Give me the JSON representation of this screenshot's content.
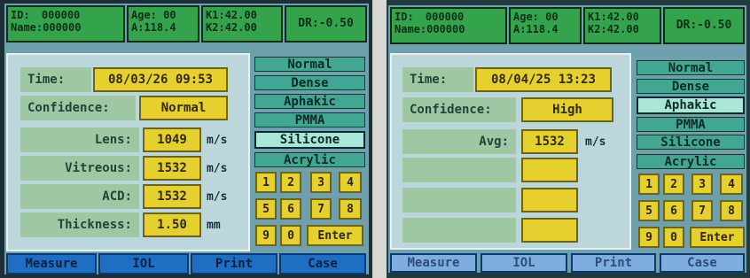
{
  "left": {
    "header": {
      "id_label": "ID:",
      "id_value": "000000",
      "name_label": "Name:",
      "name_value": "000000",
      "age_label": "Age:",
      "age_value": "00",
      "a_label": "A:",
      "a_value": "118.4",
      "k1_label": "K1:",
      "k1_value": "42.00",
      "k2_label": "K2:",
      "k2_value": "42.00",
      "dr_label": "DR:",
      "dr_value": "-0.50"
    },
    "time": {
      "label": "Time:",
      "value": "08/03/26 09:53"
    },
    "confidence": {
      "label": "Confidence:",
      "value": "Normal"
    },
    "rows": [
      {
        "label": "Lens:",
        "value": "1049",
        "unit": "m/s"
      },
      {
        "label": "Vitreous:",
        "value": "1532",
        "unit": "m/s"
      },
      {
        "label": "ACD:",
        "value": "1532",
        "unit": "m/s"
      },
      {
        "label": "Thickness:",
        "value": "1.50",
        "unit": "mm"
      }
    ],
    "modes": [
      "Normal",
      "Dense",
      "Aphakic",
      "PMMA",
      "Silicone",
      "Acrylic"
    ],
    "selected_mode": "Silicone",
    "keys": [
      "1",
      "2",
      "3",
      "4",
      "5",
      "6",
      "7",
      "8",
      "9",
      "0",
      "Enter"
    ],
    "tabs": [
      "Measure",
      "IOL",
      "Print",
      "Case"
    ]
  },
  "right": {
    "header": {
      "id_label": "ID:",
      "id_value": "000000",
      "name_label": "Name:",
      "name_value": "000000",
      "age_label": "Age:",
      "age_value": "00",
      "a_label": "A:",
      "a_value": "118.4",
      "k1_label": "K1:",
      "k1_value": "42.00",
      "k2_label": "K2:",
      "k2_value": "42.00",
      "dr_label": "DR:",
      "dr_value": "-0.50"
    },
    "time": {
      "label": "Time:",
      "value": "08/04/25 13:23"
    },
    "confidence": {
      "label": "Confidence:",
      "value": "High"
    },
    "avg": {
      "label": "Avg:",
      "value": "1532",
      "unit": "m/s"
    },
    "modes": [
      "Normal",
      "Dense",
      "Aphakic",
      "PMMA",
      "Silicone",
      "Acrylic"
    ],
    "selected_mode": "Aphakic",
    "keys": [
      "1",
      "2",
      "3",
      "4",
      "5",
      "6",
      "7",
      "8",
      "9",
      "0",
      "Enter"
    ],
    "tabs": [
      "Measure",
      "IOL",
      "Print",
      "Case"
    ]
  },
  "colors": {
    "header_green": "#34a44c",
    "field_yellow": "#e6d02e",
    "mode_teal": "#41a792",
    "tab_blue": "#1e6fc4",
    "screen_bg": "#6ea0ad",
    "panel_bg": "#bcd7db"
  }
}
